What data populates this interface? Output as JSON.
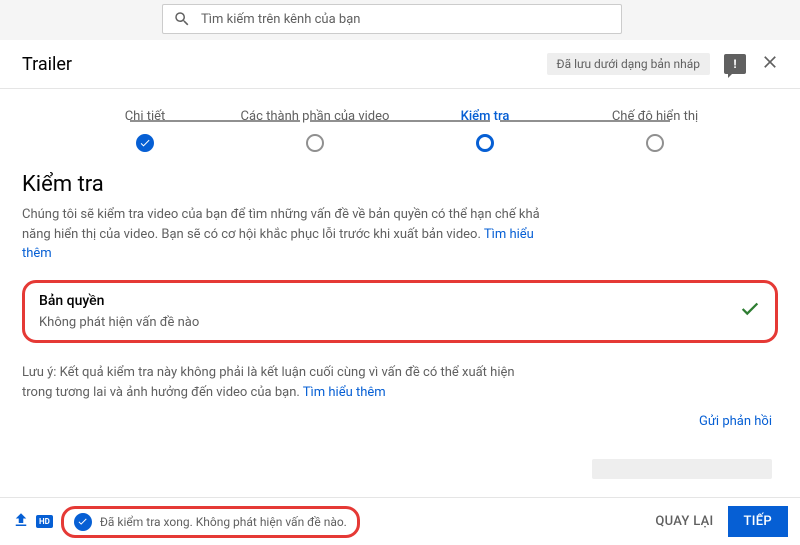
{
  "search": {
    "placeholder": "Tìm kiếm trên kênh của bạn"
  },
  "header": {
    "title": "Trailer",
    "draft_badge": "Đã lưu dưới dạng bản nháp"
  },
  "stepper": {
    "steps": [
      {
        "label": "Chi tiết",
        "state": "done"
      },
      {
        "label": "Các thành phần của video",
        "state": "pending"
      },
      {
        "label": "Kiểm tra",
        "state": "active"
      },
      {
        "label": "Chế độ hiển thị",
        "state": "pending"
      }
    ]
  },
  "checks": {
    "title": "Kiểm tra",
    "description_prefix": "Chúng tôi sẽ kiểm tra video của bạn để tìm những vấn đề về bản quyền có thể hạn chế khả năng hiển thị của video. Bạn sẽ có cơ hội khắc phục lỗi trước khi xuất bản video. ",
    "learn_more": "Tìm hiểu thêm",
    "copyright": {
      "title": "Bản quyền",
      "status": "Không phát hiện vấn đề nào"
    },
    "note_prefix": "Lưu ý: Kết quả kiểm tra này không phải là kết luận cuối cùng vì vấn đề có thể xuất hiện trong tương lai và ảnh hưởng đến video của bạn. ",
    "note_learn_more": "Tìm hiểu thêm",
    "send_feedback": "Gửi phản hồi"
  },
  "footer": {
    "hd_label": "HD",
    "status_text": "Đã kiểm tra xong. Không phát hiện vấn đề nào.",
    "back": "QUAY LẠI",
    "next": "TIẾP"
  }
}
